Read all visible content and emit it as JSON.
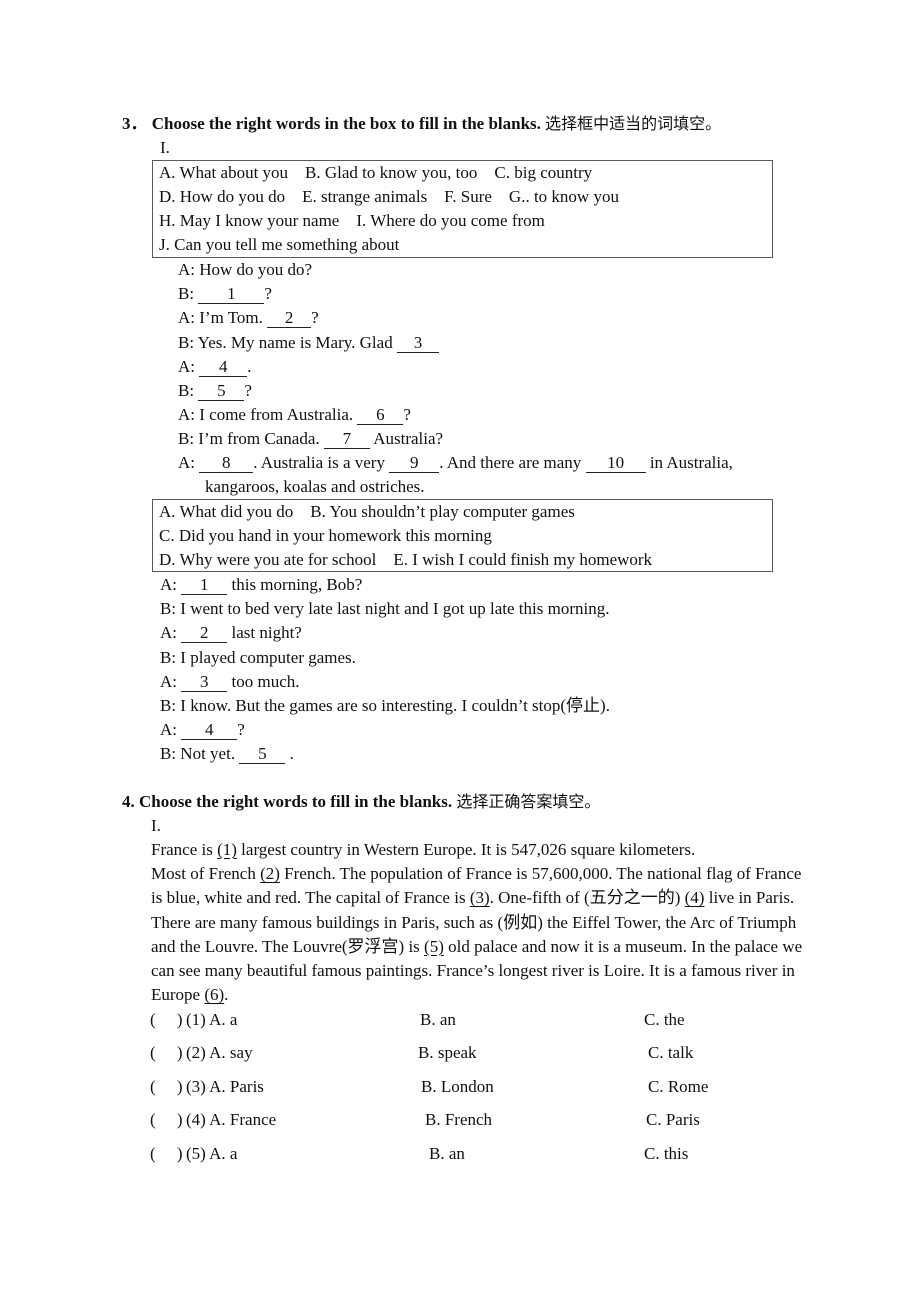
{
  "section3": {
    "number": "3．",
    "title": "Choose the right words in the box to fill in the blanks.",
    "title_cn": "选择框中适当的词填空。",
    "part_label": "I.",
    "box1": [
      "A. What about you    B. Glad to know you, too    C. big country",
      "D. How do you do    E. strange animals    F. Sure    G.. to know you",
      "H. May I know your name    I. Where do you come from",
      "J. Can you tell me something about"
    ],
    "dialogue1": [
      {
        "pre": "A: How do you do?",
        "blank": "",
        "post": ""
      },
      {
        "pre": "B: ",
        "blank": "1",
        "post": "?"
      },
      {
        "pre": "A: I’m Tom. ",
        "blank": "2",
        "post": "?"
      },
      {
        "pre": "B: Yes. My name is Mary. Glad ",
        "blank": "3",
        "post": ""
      },
      {
        "pre": "A: ",
        "blank": "4",
        "post": "."
      },
      {
        "pre": "B: ",
        "blank": "5",
        "post": "?"
      },
      {
        "pre": "A: I come from Australia. ",
        "blank": "6",
        "post": "?"
      },
      {
        "pre": "B: I’m from Canada. ",
        "blank": "7",
        "post": " Australia?"
      }
    ],
    "line_8_10": {
      "a": "A: ",
      "b8": "8",
      "t1": ". Australia is a very ",
      "b9": "9",
      "t2": ". And there are many ",
      "b10": "10",
      "t3": " in Australia,",
      "cont": "kangaroos, koalas and ostriches."
    },
    "box2": [
      "A. What did you do    B. You shouldn’t play computer games",
      "C. Did you hand in your homework this morning",
      "D. Why were you ate for school    E. I wish I could finish my homework"
    ],
    "dialogue2": [
      {
        "pre": "A: ",
        "blank": "1",
        "post": " this morning, Bob?"
      },
      {
        "pre": "B: I went to bed very late last night and I got up late this morning.",
        "blank": "",
        "post": ""
      },
      {
        "pre": "A: ",
        "blank": "2",
        "post": " last night?"
      },
      {
        "pre": "B: I played computer games.",
        "blank": "",
        "post": ""
      },
      {
        "pre": "A: ",
        "blank": "3",
        "post": " too much."
      },
      {
        "pre": "B: I know. But the games are so interesting. I couldn’t stop(停止).",
        "blank": "",
        "post": ""
      },
      {
        "pre": "A: ",
        "blank": "4",
        "post": "?"
      },
      {
        "pre": "B: Not yet. ",
        "blank": "5",
        "post": " ."
      }
    ]
  },
  "section4": {
    "title": "4. Choose the right words to fill in the blanks.",
    "title_cn": "选择正确答案填空。",
    "part_label": "I.",
    "passage": [
      {
        "t": "France is "
      },
      {
        "u": "(1)"
      },
      {
        "t": " largest country in Western Europe. It is 547,026 square kilometers. "
      },
      {
        "br": true
      },
      {
        "t": "Most of French "
      },
      {
        "u": "(2)"
      },
      {
        "t": " French. The population of France is 57,600,000. The national flag of France is blue, white and red. The capital of France is "
      },
      {
        "u": "(3)"
      },
      {
        "t": ". One-fifth of (五分之一的) "
      },
      {
        "u": "(4)"
      },
      {
        "t": " live in Paris. There are many famous buildings in Paris, such as (例如) the Eiffel Tower, the Arc of Triumph and the Louvre. The Louvre(罗浮宫) is "
      },
      {
        "u": "(5)"
      },
      {
        "t": " old palace and now it is a museum. In the palace we can see many beautiful famous paintings. France’s longest river is Loire. It is a famous river in Europe "
      },
      {
        "u": "(6)"
      },
      {
        "t": "."
      }
    ],
    "questions": [
      {
        "bracket": "(    )",
        "num": "(1)",
        "a": "A. a",
        "b": "B. an",
        "c": "C. the"
      },
      {
        "bracket": "(    )",
        "num": "(2)",
        "a": "A. say",
        "b": "B. speak",
        "c": "C. talk"
      },
      {
        "bracket": "(    )",
        "num": "(3)",
        "a": "A. Paris",
        "b": "B. London",
        "c": "C. Rome"
      },
      {
        "bracket": "(    )",
        "num": "(4)",
        "a": "A. France",
        "b": "B. French",
        "c": "C. Paris"
      },
      {
        "bracket": "(    )",
        "num": "(5)",
        "a": "A. a",
        "b": "B. an",
        "c": "C. this"
      }
    ]
  }
}
